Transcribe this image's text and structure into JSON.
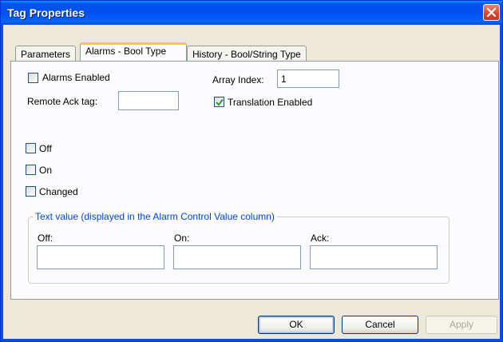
{
  "window": {
    "title": "Tag Properties"
  },
  "tabs": [
    {
      "label": "Parameters"
    },
    {
      "label": "Alarms - Bool Type"
    },
    {
      "label": "History - Bool/String Type"
    }
  ],
  "alarms": {
    "alarms_enabled": {
      "label": "Alarms Enabled",
      "checked": false
    },
    "array_index": {
      "label": "Array Index:",
      "value": "1"
    },
    "remote_ack": {
      "label": "Remote Ack tag:",
      "value": ""
    },
    "translation_enabled": {
      "label": "Translation Enabled",
      "checked": true
    },
    "off": {
      "label": "Off",
      "checked": false
    },
    "on": {
      "label": "On",
      "checked": false
    },
    "changed": {
      "label": "Changed",
      "checked": false
    }
  },
  "text_value_group": {
    "legend": "Text value (displayed in the Alarm Control Value column)",
    "off_label": "Off:",
    "off_value": "",
    "on_label": "On:",
    "on_value": "",
    "ack_label": "Ack:",
    "ack_value": ""
  },
  "buttons": {
    "ok": "OK",
    "cancel": "Cancel",
    "apply": "Apply"
  },
  "colors": {
    "titlebar": "#0054E3",
    "group_legend": "#0046D5",
    "tab_highlight": "#FFC83C"
  }
}
